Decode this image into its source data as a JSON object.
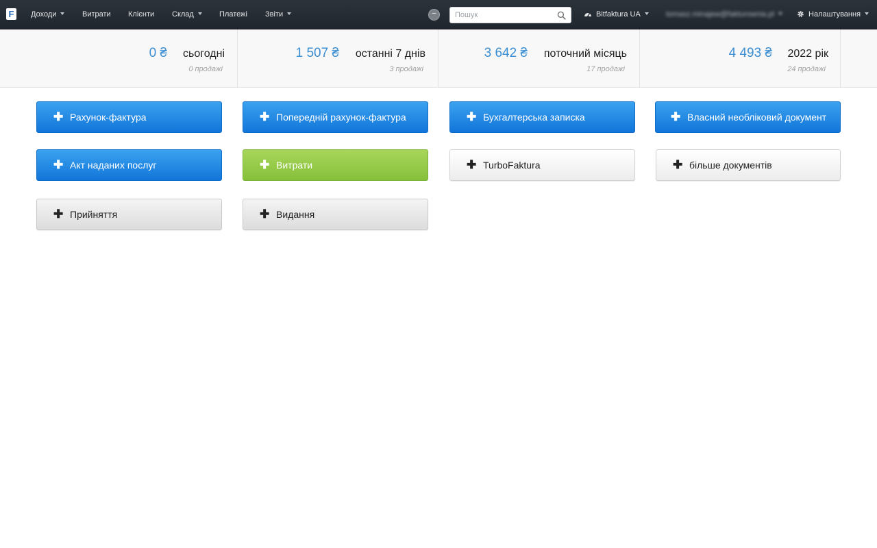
{
  "app": {
    "logo_letter": "F"
  },
  "nav": {
    "income": "Доходи",
    "expenses": "Витрати",
    "clients": "Клієнти",
    "warehouse": "Склад",
    "payments": "Платежі",
    "reports": "Звіти",
    "status_dot": "–",
    "search_placeholder": "Пошук",
    "company": "Bitfaktura UA",
    "user_email": "tomasz.minajew@fakturownia.pl",
    "settings": "Налаштування"
  },
  "stats": [
    {
      "amount": "0 ₴",
      "label": "сьогодні",
      "sub": "0 продажі"
    },
    {
      "amount": "1 507 ₴",
      "label": "останні 7 днів",
      "sub": "3 продажі"
    },
    {
      "amount": "3 642 ₴",
      "label": "поточний місяць",
      "sub": "17 продажі"
    },
    {
      "amount": "4 493 ₴",
      "label": "2022 рік",
      "sub": "24 продажі"
    }
  ],
  "actions": {
    "plus": "✚",
    "invoice": "Рахунок-фактура",
    "proforma": "Попередній рахунок-фактура",
    "accounting_note": "Бухгалтерська записка",
    "own_document": "Власний необліковий документ",
    "service_act": "Акт наданих послуг",
    "expenses": "Витрати",
    "turbofaktura": "TurboFaktura",
    "more_documents": "більше документів",
    "receipt": "Прийняття",
    "issue": "Видання"
  },
  "colors": {
    "accent_blue": "#1275d9",
    "accent_green": "#86c03a",
    "amount_blue": "#3a8ed3",
    "navbar": "#232a31"
  }
}
